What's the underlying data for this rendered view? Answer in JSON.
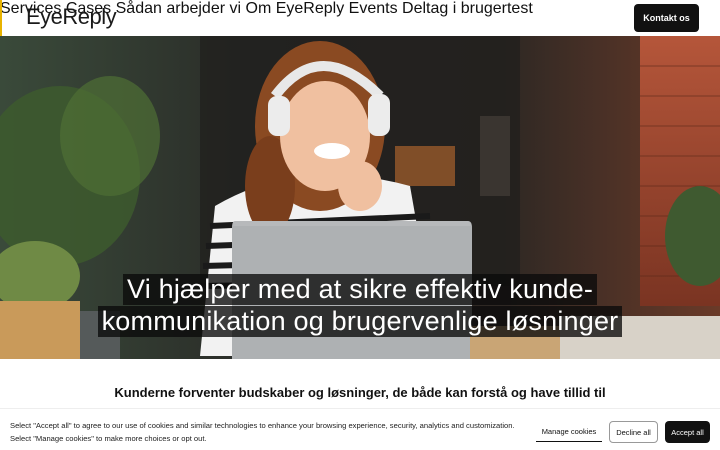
{
  "header": {
    "logo": "EyeReply",
    "nav": [
      {
        "label": "Services"
      },
      {
        "label": "Cases"
      },
      {
        "label": "Sådan arbejder vi"
      },
      {
        "label": "Om EyeReply"
      },
      {
        "label": "Events"
      },
      {
        "label": "Deltag i brugertest"
      }
    ],
    "contact_label": "Kontakt os",
    "accent_color": "#e8b300"
  },
  "hero": {
    "line1": "Vi hjælper med at sikre effektiv kunde-",
    "line2": "kommunikation og brugervenlige løsninger"
  },
  "subheading": "Kunderne forventer budskaber og løsninger, de både kan forstå og have tillid til",
  "cookie": {
    "line1": "Select \"Accept all\" to agree to our use of cookies and similar technologies to enhance your browsing experience, security, analytics and customization.",
    "line2": "Select \"Manage cookies\" to make more choices or opt out.",
    "manage_label": "Manage cookies",
    "decline_label": "Decline all",
    "accept_label": "Accept all"
  }
}
